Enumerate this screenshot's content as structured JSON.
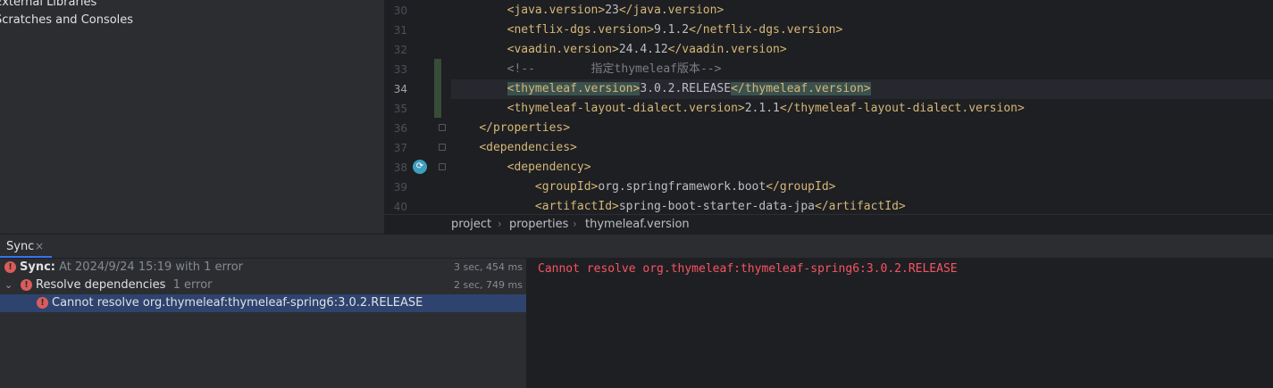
{
  "project_tree": {
    "items": [
      "External Libraries",
      "Scratches and Consoles"
    ]
  },
  "editor": {
    "current_line": "34",
    "lines": [
      {
        "num": "30",
        "indent": "        ",
        "parts": [
          [
            "tag",
            "<java.version>"
          ],
          [
            "txt",
            "23"
          ],
          [
            "tag",
            "</java.version>"
          ]
        ]
      },
      {
        "num": "31",
        "indent": "        ",
        "parts": [
          [
            "tag",
            "<netflix-dgs.version>"
          ],
          [
            "txt",
            "9.1.2"
          ],
          [
            "tag",
            "</netflix-dgs.version>"
          ]
        ]
      },
      {
        "num": "32",
        "indent": "        ",
        "parts": [
          [
            "tag",
            "<vaadin.version>"
          ],
          [
            "txt",
            "24.4.12"
          ],
          [
            "tag",
            "</vaadin.version>"
          ]
        ]
      },
      {
        "num": "33",
        "indent": "        ",
        "parts": [
          [
            "cmt",
            "<!--        指定thymeleaf版本-->"
          ]
        ]
      },
      {
        "num": "34",
        "indent": "        ",
        "parts": [
          [
            "tag hl",
            "<thymeleaf.version>"
          ],
          [
            "txt",
            "3.0.2.RELEASE"
          ],
          [
            "tag hl",
            "</thymeleaf.version>"
          ]
        ]
      },
      {
        "num": "35",
        "indent": "        ",
        "parts": [
          [
            "tag",
            "<thymeleaf-layout-dialect.version>"
          ],
          [
            "txt",
            "2.1.1"
          ],
          [
            "tag",
            "</thymeleaf-layout-dialect.version>"
          ]
        ]
      },
      {
        "num": "36",
        "indent": "    ",
        "parts": [
          [
            "tag",
            "</properties>"
          ]
        ]
      },
      {
        "num": "37",
        "indent": "    ",
        "parts": [
          [
            "tag",
            "<dependencies>"
          ]
        ]
      },
      {
        "num": "38",
        "indent": "        ",
        "parts": [
          [
            "tag",
            "<dependency>"
          ]
        ]
      },
      {
        "num": "39",
        "indent": "            ",
        "parts": [
          [
            "tag",
            "<groupId>"
          ],
          [
            "txt",
            "org.springframework.boot"
          ],
          [
            "tag",
            "</groupId>"
          ]
        ]
      },
      {
        "num": "40",
        "indent": "            ",
        "parts": [
          [
            "tag",
            "<artifactId>"
          ],
          [
            "txt",
            "spring-boot-starter-data-jpa"
          ],
          [
            "tag",
            "</artifactId>"
          ]
        ]
      }
    ]
  },
  "breadcrumb": {
    "items": [
      "project",
      "properties",
      "thymeleaf.version"
    ],
    "separator": "›"
  },
  "tool_window": {
    "tab_label": "Sync",
    "tab_close": "×"
  },
  "sync_tree": {
    "root": {
      "label": "Sync:",
      "detail": "At 2024/9/24 15:19 with 1 error",
      "time": "3 sec, 454 ms"
    },
    "resolve": {
      "label": "Resolve dependencies",
      "detail": "1 error",
      "time": "2 sec, 749 ms"
    },
    "error_item": {
      "label": "Cannot resolve org.thymeleaf:thymeleaf-spring6:3.0.2.RELEASE"
    }
  },
  "console": {
    "message": "Cannot resolve org.thymeleaf:thymeleaf-spring6:3.0.2.RELEASE"
  },
  "colors": {
    "error": "#f75464",
    "tag": "#d5b778",
    "accent": "#3574f0"
  }
}
